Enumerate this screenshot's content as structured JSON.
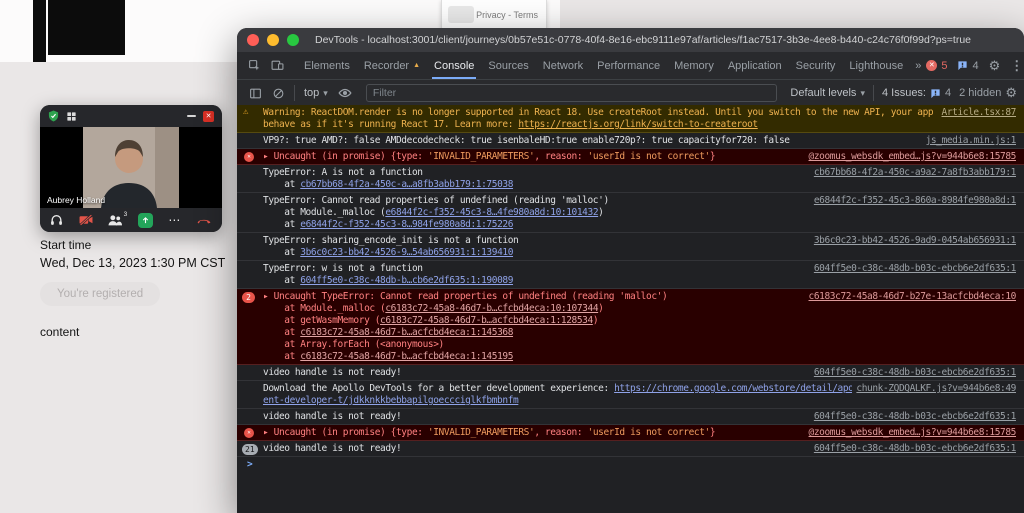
{
  "desktop": {
    "privacy_terms": "Privacy - Terms"
  },
  "meeting": {
    "participant_name": "Aubrey Holland",
    "participants_count": "3",
    "start_time_label": "Start time",
    "start_time_value": "Wed, Dec 13, 2023 1:30 PM CST",
    "registered_button": "You're registered",
    "content_text": "content"
  },
  "icons": {
    "error_x": "✕",
    "warning_triangle": "⚠",
    "prompt_caret": ">",
    "recorder_badge": "▲"
  },
  "colors": {
    "error_red": "#ff8080",
    "warning_yellow": "#f3ab26",
    "accent_blue": "#7cacf8",
    "share_green": "#23a55a"
  },
  "devtools": {
    "title": "DevTools - localhost:3001/client/journeys/0b57e51c-0778-40f4-8e16-ebc9111e97af/articles/f1ac7517-3b3e-4ee8-b440-c24c76f0f99d?ps=true",
    "error_count": "5",
    "message_count": "4",
    "tabs": [
      {
        "label": "Elements",
        "active": false
      },
      {
        "label": "Recorder",
        "active": false,
        "badge": "recorder_badge"
      },
      {
        "label": "Console",
        "active": true
      },
      {
        "label": "Sources",
        "active": false
      },
      {
        "label": "Network",
        "active": false
      },
      {
        "label": "Performance",
        "active": false
      },
      {
        "label": "Memory",
        "active": false
      },
      {
        "label": "Application",
        "active": false
      },
      {
        "label": "Security",
        "active": false
      },
      {
        "label": "Lighthouse",
        "active": false
      }
    ],
    "console_toolbar": {
      "context": "top",
      "filter_placeholder": "Filter",
      "levels": "Default levels",
      "issues_text": "4 Issues:",
      "issues_count": "4",
      "hidden_text": "2 hidden"
    },
    "messages": [
      {
        "kind": "warning",
        "source": "Article.tsx:87",
        "lines": [
          [
            {
              "t": "Warning: ReactDOM.render is no longer supported in React 18. Use createRoot instead. Until you switch to the new API, your app will"
            }
          ],
          [
            {
              "t": "behave as if it's running React 17. Learn more: "
            },
            {
              "t": "https://reactjs.org/link/switch-to-createroot",
              "s": "link"
            }
          ]
        ]
      },
      {
        "kind": "log",
        "source": "js_media.min.js:1",
        "lines": [
          [
            {
              "t": "VP9?: true AMD?: false AMDdecodecheck: true isenbaleHD:true enable720p?: true capacityfor720: false"
            }
          ]
        ]
      },
      {
        "kind": "error",
        "source": "@zoomus_websdk_embed…js?v=944b6e8:15785",
        "lines": [
          [
            {
              "t": "▸ ",
              "s": "caret"
            },
            {
              "t": "Uncaught (in promise) "
            },
            {
              "t": "{type: "
            },
            {
              "t": "'INVALID_PARAMETERS'",
              "s": "str"
            },
            {
              "t": ", reason: "
            },
            {
              "t": "'userId is not correct'",
              "s": "str"
            },
            {
              "t": "}"
            }
          ]
        ]
      },
      {
        "kind": "log",
        "source": "cb67bb68-4f2a-450c-a9a2-7a8fb3abb179:1",
        "lines": [
          [
            {
              "t": "TypeError: A is not a function"
            }
          ],
          [
            {
              "t": "    at "
            },
            {
              "t": "cb67bb68-4f2a-450c-a…a8fb3abb179:1:75038",
              "s": "link"
            }
          ]
        ]
      },
      {
        "kind": "log",
        "source": "e6844f2c-f352-45c3-860a-8984fe980a8d:1",
        "lines": [
          [
            {
              "t": "TypeError: Cannot read properties of undefined (reading 'malloc')"
            }
          ],
          [
            {
              "t": "    at Module._malloc ("
            },
            {
              "t": "e6844f2c-f352-45c3-8…4fe980a8d:10:101432",
              "s": "link"
            },
            {
              "t": ")"
            }
          ],
          [
            {
              "t": "    at "
            },
            {
              "t": "e6844f2c-f352-45c3-8…984fe980a8d:1:75226",
              "s": "link"
            }
          ]
        ]
      },
      {
        "kind": "log",
        "source": "3b6c0c23-bb42-4526-9ad9-0454ab656931:1",
        "lines": [
          [
            {
              "t": "TypeError: sharing_encode_init is not a function"
            }
          ],
          [
            {
              "t": "    at "
            },
            {
              "t": "3b6c0c23-bb42-4526-9…54ab656931:1:139410",
              "s": "link"
            }
          ]
        ]
      },
      {
        "kind": "log",
        "source": "604ff5e0-c38c-48db-b03c-ebcb6e2df635:1",
        "lines": [
          [
            {
              "t": "TypeError: w is not a function"
            }
          ],
          [
            {
              "t": "    at "
            },
            {
              "t": "604ff5e0-c38c-48db-b…cb6e2df635:1:190089",
              "s": "link"
            }
          ]
        ]
      },
      {
        "kind": "error",
        "badge": "2",
        "source": "c6183c72-45a8-46d7-b27e-13acfcbd4eca:10",
        "lines": [
          [
            {
              "t": "▸ ",
              "s": "caret"
            },
            {
              "t": "Uncaught TypeError: Cannot read properties of undefined (reading 'malloc')"
            }
          ],
          [
            {
              "t": "    at Module._malloc ("
            },
            {
              "t": "c6183c72-45a8-46d7-b…cfcbd4eca:10:107344",
              "s": "link"
            },
            {
              "t": ")"
            }
          ],
          [
            {
              "t": "    at getWasmMemory ("
            },
            {
              "t": "c6183c72-45a8-46d7-b…acfcbd4eca:1:128534",
              "s": "link"
            },
            {
              "t": ")"
            }
          ],
          [
            {
              "t": "    at "
            },
            {
              "t": "c6183c72-45a8-46d7-b…acfcbd4eca:1:145368",
              "s": "link"
            }
          ],
          [
            {
              "t": "    at Array.forEach (<anonymous>)"
            }
          ],
          [
            {
              "t": "    at "
            },
            {
              "t": "c6183c72-45a8-46d7-b…acfcbd4eca:1:145195",
              "s": "link"
            }
          ]
        ]
      },
      {
        "kind": "log",
        "source": "604ff5e0-c38c-48db-b03c-ebcb6e2df635:1",
        "lines": [
          [
            {
              "t": "video handle is not ready!"
            }
          ]
        ]
      },
      {
        "kind": "log",
        "source": "chunk-ZQDQALKF.js?v=944b6e8:49",
        "lines": [
          [
            {
              "t": "Download the Apollo DevTools for a better development experience: "
            },
            {
              "t": "https://chrome.google.com/webstore/detail/apollo-cli",
              "s": "link"
            }
          ],
          [
            {
              "t": "ent-developer-t/jdkknkkbebbapilgoeccciglkfbmbnfm",
              "s": "link"
            }
          ]
        ]
      },
      {
        "kind": "log",
        "source": "604ff5e0-c38c-48db-b03c-ebcb6e2df635:1",
        "lines": [
          [
            {
              "t": "video handle is not ready!"
            }
          ]
        ]
      },
      {
        "kind": "error",
        "source": "@zoomus_websdk_embed…js?v=944b6e8:15785",
        "lines": [
          [
            {
              "t": "▸ ",
              "s": "caret"
            },
            {
              "t": "Uncaught (in promise) "
            },
            {
              "t": "{type: "
            },
            {
              "t": "'INVALID_PARAMETERS'",
              "s": "str"
            },
            {
              "t": ", reason: "
            },
            {
              "t": "'userId is not correct'",
              "s": "str"
            },
            {
              "t": "}"
            }
          ]
        ]
      },
      {
        "kind": "log",
        "badge": "21",
        "source": "604ff5e0-c38c-48db-b03c-ebcb6e2df635:1",
        "lines": [
          [
            {
              "t": "video handle is not ready!"
            }
          ]
        ]
      },
      {
        "kind": "prompt",
        "lines": []
      }
    ]
  }
}
